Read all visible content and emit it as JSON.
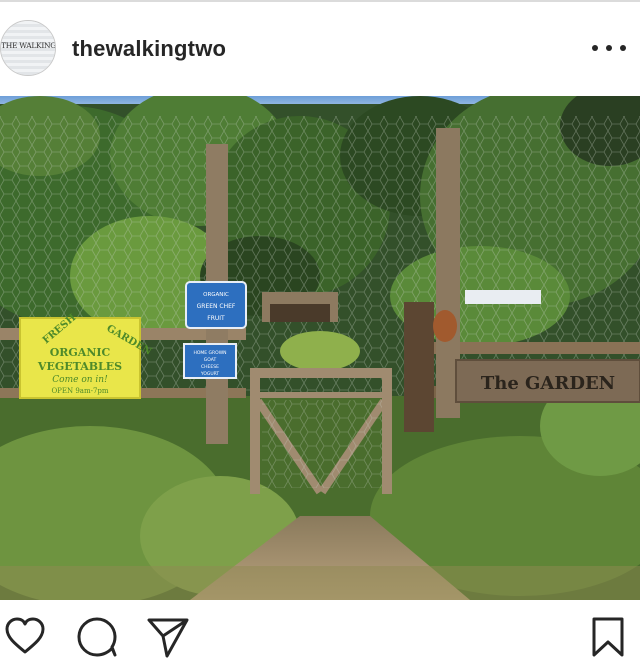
{
  "post": {
    "username": "thewalkingtwo",
    "avatar_text": "THE WALKING TWO",
    "more_icon": "more-horizontal-icon"
  },
  "photo": {
    "signs": {
      "yellow_top_left": "FRESH",
      "yellow_top_right": "GARDEN",
      "yellow_line1": "ORGANIC",
      "yellow_line2": "VEGETABLES",
      "yellow_line3": "Come on in!",
      "yellow_line4": "OPEN   9am-7pm",
      "blue_top_line1": "ORGANIC",
      "blue_top_line2": "GREEN CHEF",
      "blue_top_line3": "FRUIT",
      "blue_bottom_line1": "HOME GROWN",
      "blue_bottom_line2": "GOAT",
      "blue_bottom_line3": "CHEESE",
      "blue_bottom_line4": "YOGURT",
      "garden_sign": "The GARDEN"
    }
  },
  "actions": {
    "like_icon": "heart-icon",
    "comment_icon": "comment-icon",
    "share_icon": "send-icon",
    "save_icon": "bookmark-icon"
  }
}
